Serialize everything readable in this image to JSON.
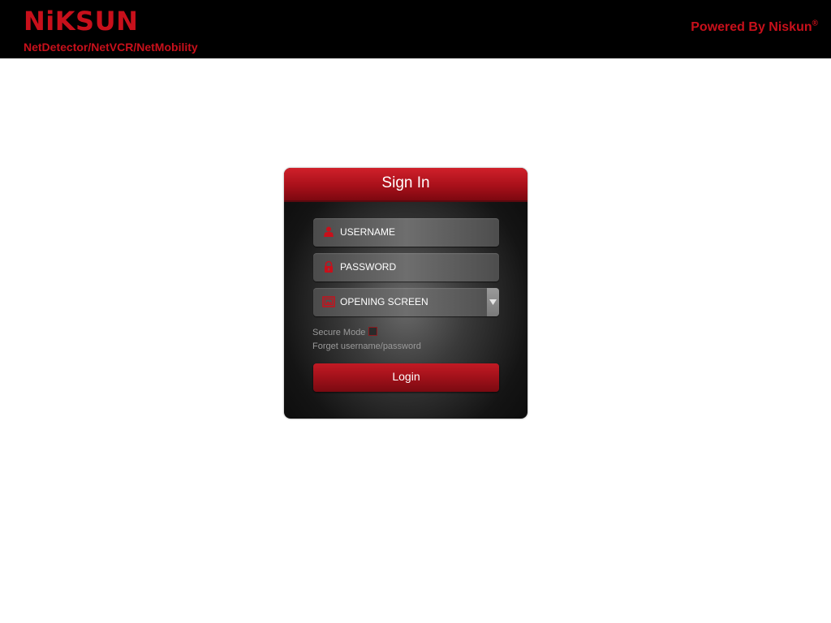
{
  "header": {
    "logo_text": "NiKSUN",
    "product_line": "NetDetector/NetVCR/NetMobility",
    "powered_by": "Powered By Niskun",
    "registered_mark": "®",
    "brand_color": "#c8101b",
    "background_color": "#000000"
  },
  "signin": {
    "title": "Sign In",
    "username": {
      "placeholder": "USERNAME",
      "icon": "user-icon"
    },
    "password": {
      "placeholder": "PASSWORD",
      "icon": "lock-icon"
    },
    "opening_screen": {
      "selected": "OPENING SCREEN",
      "icon": "screen-icon"
    },
    "secure_mode_label": "Secure Mode",
    "secure_mode_checked": false,
    "forgot_link": "Forget username/password",
    "login_label": "Login",
    "accent_color": "#a8101a"
  }
}
